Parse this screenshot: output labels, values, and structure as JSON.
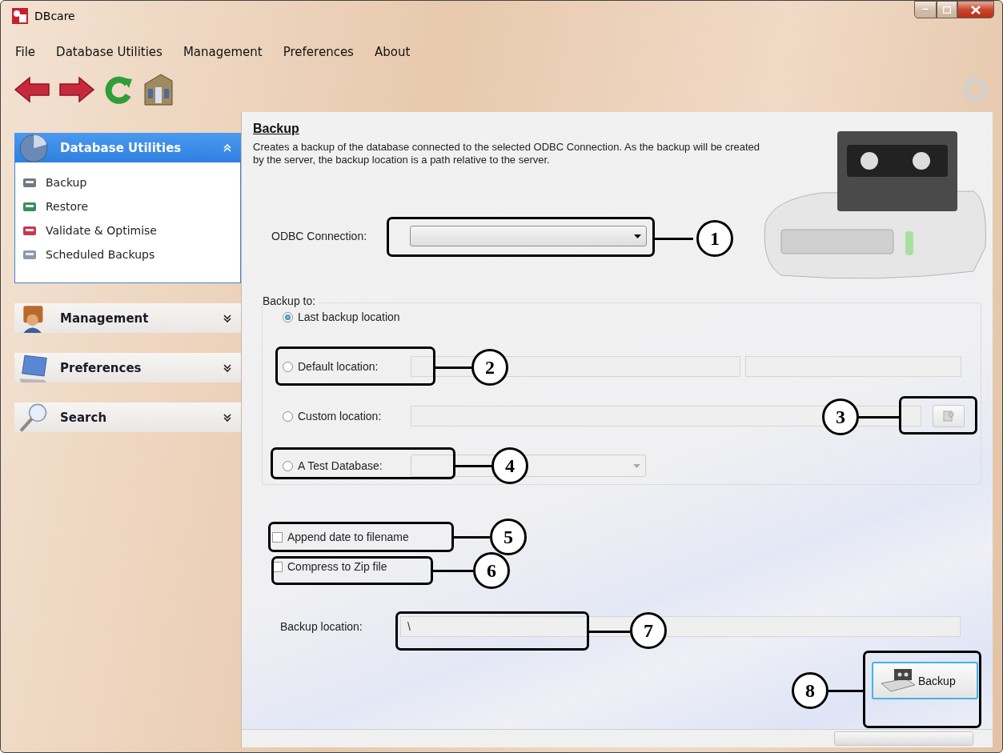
{
  "window": {
    "title": "DBcare"
  },
  "menu": [
    "File",
    "Database Utilities",
    "Management",
    "Preferences",
    "About"
  ],
  "sidebar": {
    "groups": [
      {
        "title": "Database Utilities",
        "kind": "database",
        "expanded": true,
        "items": [
          "Backup",
          "Restore",
          "Validate & Optimise",
          "Scheduled Backups"
        ]
      },
      {
        "title": "Management",
        "kind": "management",
        "expanded": false
      },
      {
        "title": "Preferences",
        "kind": "preferences",
        "expanded": false
      },
      {
        "title": "Search",
        "kind": "search",
        "expanded": false
      }
    ]
  },
  "panel": {
    "title": "Backup",
    "description": "Creates a backup of the database connected to the selected ODBC Connection. As the backup will be created by the server, the backup location is a path relative to the server.",
    "odbc_label": "ODBC Connection:",
    "group_label": "Backup to:",
    "options": [
      {
        "label": "Last backup location",
        "kind": "plain",
        "selected": true
      },
      {
        "label": "Default location:",
        "kind": "two_fields",
        "selected": false
      },
      {
        "label": "Custom location:",
        "kind": "browse",
        "selected": false
      },
      {
        "label": "A Test Database:",
        "kind": "combo",
        "selected": false
      }
    ],
    "checkboxes": [
      {
        "label": "Append date to filename",
        "checked": false
      },
      {
        "label": "Compress to Zip file",
        "checked": false
      }
    ],
    "location_label": "Backup location:",
    "location_value": "\\",
    "button": "Backup"
  },
  "callouts": [
    "1",
    "2",
    "3",
    "4",
    "5",
    "6",
    "7",
    "8"
  ]
}
